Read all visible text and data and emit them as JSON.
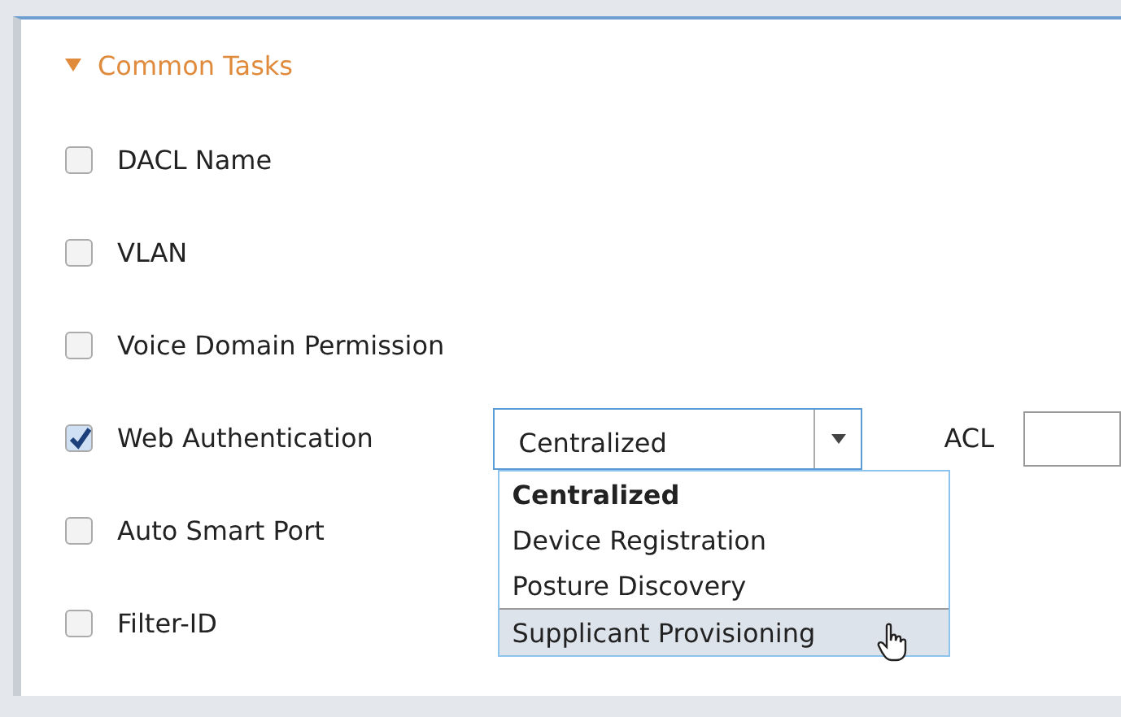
{
  "section": {
    "title": "Common Tasks",
    "expanded": true
  },
  "tasks": [
    {
      "label": "DACL Name",
      "checked": false
    },
    {
      "label": "VLAN",
      "checked": false
    },
    {
      "label": "Voice Domain Permission",
      "checked": false
    },
    {
      "label": "Web Authentication",
      "checked": true,
      "select": {
        "value": "Centralized",
        "options": [
          {
            "label": "Centralized",
            "selected": true,
            "hovered": false
          },
          {
            "label": "Device Registration",
            "selected": false,
            "hovered": false
          },
          {
            "label": "Posture Discovery",
            "selected": false,
            "hovered": false
          },
          {
            "label": "Supplicant Provisioning",
            "selected": false,
            "hovered": true
          }
        ]
      },
      "acl_label": "ACL"
    },
    {
      "label": "Auto Smart Port",
      "checked": false
    },
    {
      "label": "Filter-ID",
      "checked": false
    }
  ]
}
